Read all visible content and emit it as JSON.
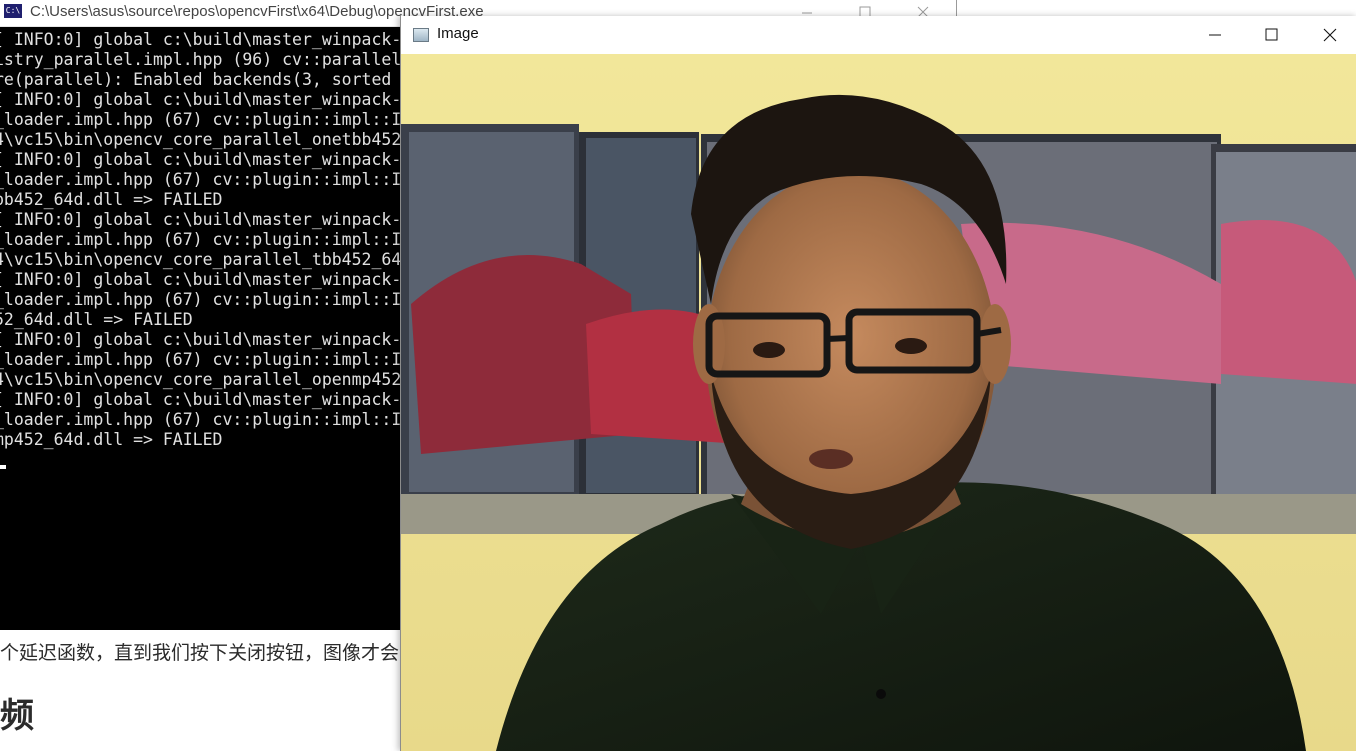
{
  "doc": {
    "line": "个延迟函数，直到我们按下关闭按钮，图像才会",
    "heading": "频"
  },
  "console": {
    "icon_label": "C:\\",
    "title": "C:\\Users\\asus\\source\\repos\\opencvFirst\\x64\\Debug\\opencvFirst.exe",
    "lines": [
      "[ INFO:0] global c:\\build\\master_winpack-",
      "istry_parallel.impl.hpp (96) cv::parallel",
      "re(parallel): Enabled backends(3, sorted ",
      "[ INFO:0] global c:\\build\\master_winpack-",
      "_loader.impl.hpp (67) cv::plugin::impl::I",
      "4\\vc15\\bin\\opencv_core_parallel_onetbb452",
      "[ INFO:0] global c:\\build\\master_winpack-",
      "_loader.impl.hpp (67) cv::plugin::impl::I",
      "bb452_64d.dll => FAILED",
      "[ INFO:0] global c:\\build\\master_winpack-",
      "_loader.impl.hpp (67) cv::plugin::impl::I",
      "4\\vc15\\bin\\opencv_core_parallel_tbb452_64",
      "[ INFO:0] global c:\\build\\master_winpack-",
      "_loader.impl.hpp (67) cv::plugin::impl::I",
      "52_64d.dll => FAILED",
      "[ INFO:0] global c:\\build\\master_winpack-",
      "_loader.impl.hpp (67) cv::plugin::impl::I",
      "4\\vc15\\bin\\opencv_core_parallel_openmp452",
      "[ INFO:0] global c:\\build\\master_winpack-",
      "_loader.impl.hpp (67) cv::plugin::impl::I",
      "mp452_64d.dll => FAILED"
    ]
  },
  "image_window": {
    "title": "Image"
  },
  "icons": [
    "console-app-icon",
    "image-window-icon",
    "minimize-icon",
    "maximize-icon",
    "close-icon"
  ]
}
